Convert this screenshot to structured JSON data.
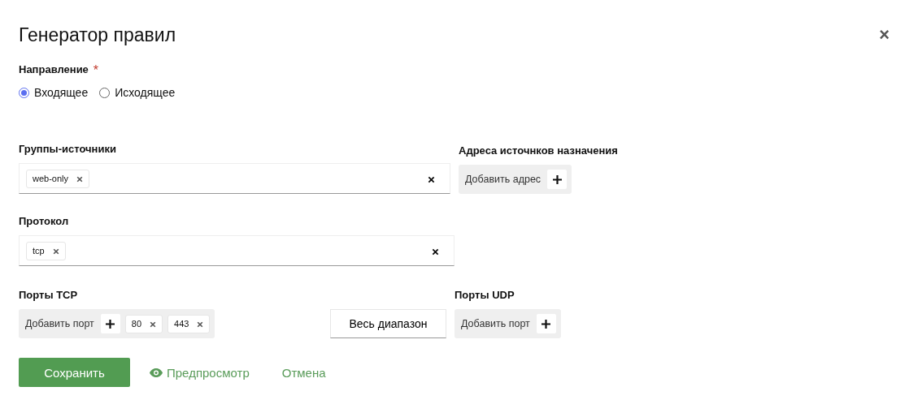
{
  "dialog": {
    "title": "Генератор правил",
    "close": "×"
  },
  "direction": {
    "label": "Направление",
    "required": "*",
    "options": [
      {
        "label": "Входящее",
        "selected": true
      },
      {
        "label": "Исходящее",
        "selected": false
      }
    ]
  },
  "source_groups": {
    "label": "Группы-источники",
    "tags": [
      "web-only"
    ]
  },
  "destination_addresses": {
    "label": "Адреса источнков назначения",
    "add": "Добавить адрес"
  },
  "protocol": {
    "label": "Протокол",
    "tags": [
      "tcp"
    ]
  },
  "tcp_ports": {
    "label": "Порты TCP",
    "add": "Добавить порт",
    "tags": [
      "80",
      "443"
    ],
    "full_range": "Весь диапазон"
  },
  "udp_ports": {
    "label": "Порты UDP",
    "add": "Добавить порт"
  },
  "actions": {
    "save": "Сохранить",
    "preview": "Предпросмотр",
    "cancel": "Отмена"
  }
}
